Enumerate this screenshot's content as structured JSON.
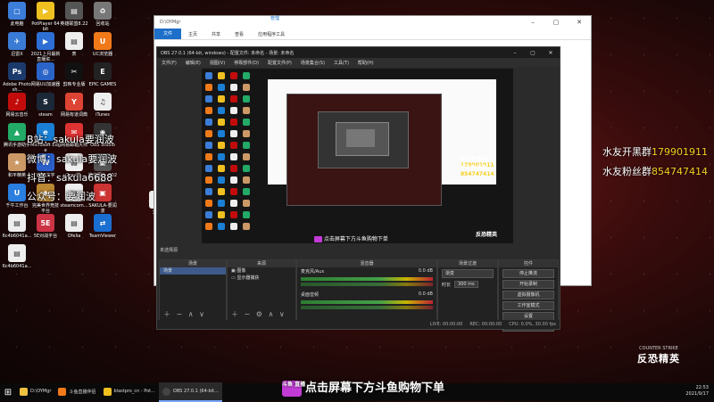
{
  "desktop": {
    "icons": [
      {
        "label": "此电脑",
        "color": "#3b7dd8",
        "glyph": "▢"
      },
      {
        "label": "PotPlayer 64 bit",
        "color": "#f0c020",
        "glyph": "▶"
      },
      {
        "label": "英雄联盟8.22",
        "color": "#555",
        "glyph": "▤"
      },
      {
        "label": "回收站",
        "color": "#777",
        "glyph": "♻"
      },
      {
        "label": "迅雷X",
        "color": "#3a7bd5",
        "glyph": "✈"
      },
      {
        "label": "2021上月最新直播资...",
        "color": "#2d6fd4",
        "glyph": "▶"
      },
      {
        "label": "表",
        "color": "#eee",
        "glyph": "▤"
      },
      {
        "label": "UC浏览器",
        "color": "#f07a1a",
        "glyph": "U"
      },
      {
        "label": "Adobe Photosh...",
        "color": "#1b3a6b",
        "glyph": "Ps"
      },
      {
        "label": "网易UU加速器",
        "color": "#2b64c8",
        "glyph": "◎"
      },
      {
        "label": "剪映专业版",
        "color": "#111",
        "glyph": "✂"
      },
      {
        "label": "EPIC GAMES",
        "color": "#222",
        "glyph": "E"
      },
      {
        "label": "网易云音乐",
        "color": "#c20c0c",
        "glyph": "♪"
      },
      {
        "label": "steam",
        "color": "#1b2838",
        "glyph": "S"
      },
      {
        "label": "网易有道词典",
        "color": "#d43",
        "glyph": "Y"
      },
      {
        "label": "iTunes",
        "color": "#eee",
        "glyph": "♫"
      },
      {
        "label": "腾讯手游助手",
        "color": "#2a6",
        "glyph": "▲"
      },
      {
        "label": "Microsoft Edge",
        "color": "#1a7fd4",
        "glyph": "e"
      },
      {
        "label": "网易邮箱大师",
        "color": "#d33",
        "glyph": "✉"
      },
      {
        "label": "OBS Studio",
        "color": "#333",
        "glyph": "◉"
      },
      {
        "label": "和平精英",
        "color": "#c96",
        "glyph": "★"
      },
      {
        "label": "WPS文字",
        "color": "#2b5fc9",
        "glyph": "W"
      },
      {
        "label": "u2ray的...",
        "color": "#eee",
        "glyph": "▤"
      },
      {
        "label": "微信图片_2021082...",
        "color": "#555",
        "glyph": "▣"
      },
      {
        "label": "千牛工作台",
        "color": "#2a7fe0",
        "glyph": "U"
      },
      {
        "label": "完美世界竞技平台",
        "color": "#b83",
        "glyph": "◆"
      },
      {
        "label": "steamcom...",
        "color": "#eee",
        "glyph": "▤"
      },
      {
        "label": "SAKULA-要润波",
        "color": "#c33",
        "glyph": "▣"
      },
      {
        "label": "6c4b6041a...",
        "color": "#eee",
        "glyph": "▤"
      },
      {
        "label": "5E对战平台",
        "color": "#c34",
        "glyph": "5E"
      },
      {
        "label": "Ofelia",
        "color": "#eee",
        "glyph": "▤"
      },
      {
        "label": "TeamViewer",
        "color": "#1a6fd0",
        "glyph": "⇄"
      },
      {
        "label": "6c4b6041a...",
        "color": "#eee",
        "glyph": "▤"
      }
    ],
    "extra_label": "3417",
    "extra_icon_label": "Microsoft Store"
  },
  "social": [
    {
      "label": "B站：sakula要润波"
    },
    {
      "label": "微博：sakula要润波"
    },
    {
      "label": "抖音：sakula6688"
    },
    {
      "label": "公众号：要润波"
    }
  ],
  "overlay_right": [
    {
      "text": "水友开黑群",
      "num": "179901911"
    },
    {
      "text": "水友粉丝群",
      "num": "854747414"
    }
  ],
  "explorer": {
    "title": "D:\\OYMgr",
    "tabs": [
      "文件",
      "主页",
      "共享",
      "查看",
      "应用程序工具"
    ],
    "manage": "管理"
  },
  "obs": {
    "title": "OBS 27.0.1 (64-bit, windows) - 配置文件: 未命名 - 场景: 未命名",
    "menu": [
      "文件(F)",
      "编辑(E)",
      "视图(V)",
      "停靠部件(D)",
      "配置文件(P)",
      "场景集合(S)",
      "工具(T)",
      "帮助(H)"
    ],
    "preview_overlay": [
      {
        "text": "水友开黑群",
        "num": "179901911"
      },
      {
        "text": "水友粉丝群",
        "num": "854747414"
      }
    ],
    "preview_banner": "点击屏幕下方斗鱼购物下单",
    "docks_label": "未选择源",
    "docks": {
      "scenes": {
        "title": "场景",
        "items": [
          "场景"
        ]
      },
      "sources": {
        "title": "来源",
        "items": [
          "图像",
          "显示器捕获"
        ]
      },
      "mixer": {
        "title": "混音器",
        "channels": [
          {
            "name": "麦克风/Aux",
            "db": "0.0 dB"
          },
          {
            "name": "桌面音频",
            "db": "0.0 dB"
          }
        ]
      },
      "transitions": {
        "title": "场景过渡",
        "type": "渐变",
        "duration_label": "时长",
        "duration": "300 ms"
      },
      "controls": {
        "title": "控件",
        "buttons": [
          "停止推流",
          "开始录制",
          "虚拟摄像机",
          "工作室模式",
          "设置",
          "退出"
        ]
      }
    },
    "status": [
      "LIVE: 00:00:00",
      "REC: 00:00:00",
      "CPU: 0.0%, 30.00 fps"
    ]
  },
  "taskbar": {
    "start": "⊞",
    "tasks": [
      {
        "label": "D:\\OYMgr",
        "color": "#f0c040",
        "active": false
      },
      {
        "label": "斗鱼直播伴侣",
        "color": "#f07a1a",
        "active": false
      },
      {
        "label": "blastpro_cn - Pot...",
        "color": "#f0c020",
        "active": false
      },
      {
        "label": "OBS 27.0.1 (64-bit...",
        "color": "#444",
        "active": true
      }
    ],
    "banner": "点击屏幕下方斗鱼购物下单",
    "banner_logo": "斗鱼 直播",
    "clock_time": "22:53",
    "clock_date": "2021/9/17"
  },
  "watermark": {
    "small": "COUNTER STRIKE",
    "big": "反恐精英"
  }
}
